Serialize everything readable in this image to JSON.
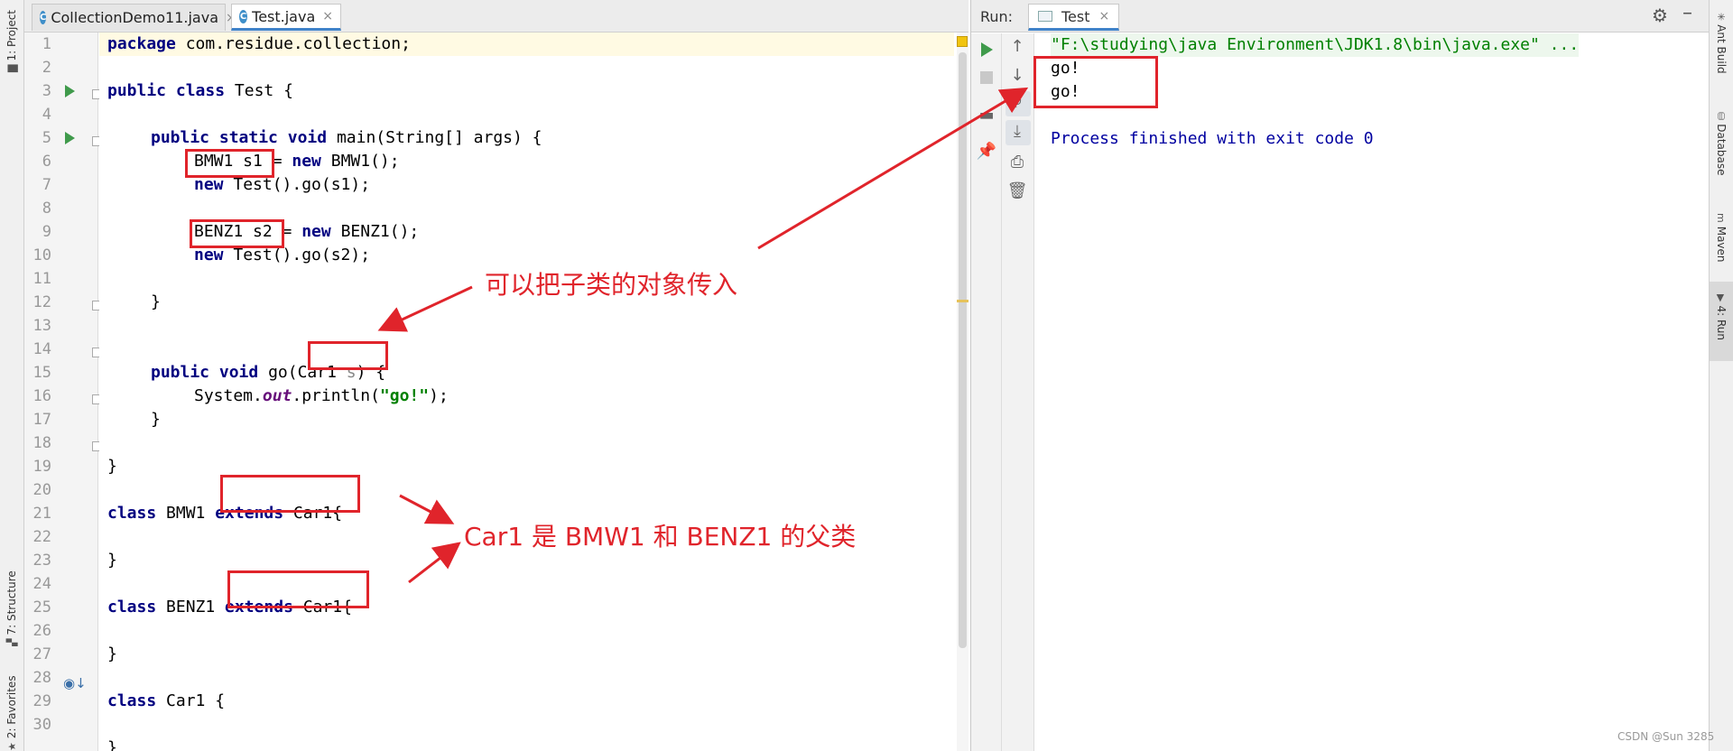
{
  "left_strip": {
    "project_label": "1: Project",
    "structure_label": "7: Structure",
    "favorites_label": "2: Favorites"
  },
  "editor": {
    "tabs": [
      {
        "label": "CollectionDemo11.java",
        "active": false
      },
      {
        "label": "Test.java",
        "active": true
      }
    ],
    "tab_close_glyph": "×",
    "line_numbers": [
      "1",
      "2",
      "3",
      "4",
      "5",
      "6",
      "7",
      "8",
      "9",
      "10",
      "11",
      "12",
      "13",
      "14",
      "15",
      "16",
      "17",
      "18",
      "19",
      "20",
      "21",
      "22",
      "23",
      "24",
      "25",
      "26",
      "27",
      "28",
      "29",
      "30"
    ],
    "code": {
      "l1_kw": "package",
      "l1_rest": " com.residue.collection;",
      "l3_kw1": "public",
      "l3_kw2": "class",
      "l3_rest": " Test {",
      "l5_kw1": "public",
      "l5_kw2": "static",
      "l5_kw3": "void",
      "l5_rest": " main(String[] args) {",
      "l6_a": "BMW1 s1",
      "l6_b": " = ",
      "l6_kw": "new",
      "l6_c": " BMW1();",
      "l7_kw": "new",
      "l7_rest": " Test().go(s1);",
      "l9_a": "BENZ1 s2",
      "l9_b": " = ",
      "l9_kw": "new",
      "l9_c": " BENZ1();",
      "l10_kw": "new",
      "l10_rest": " Test().go(s2);",
      "l12": "}",
      "l14_kw1": "public",
      "l14_kw2": "void",
      "l14_a": " go(",
      "l14_b": "Car1 ",
      "l14_param": "s",
      "l14_c": ") {",
      "l15_a": "System.",
      "l15_out": "out",
      "l15_b": ".println(",
      "l15_str": "\"go!\"",
      "l15_c": ");",
      "l16": "}",
      "l18": "}",
      "l20_kw1": "class",
      "l20_a": " BMW1 ",
      "l20_kw2": "extends",
      "l20_b": " Car1{",
      "l22": "}",
      "l24_kw1": "class",
      "l24_a": " BENZ1 ",
      "l24_kw2": "extends",
      "l24_b": " Car1{",
      "l26": "}",
      "l28_kw1": "class",
      "l28_a": " Car1 {",
      "l30": "}"
    }
  },
  "run_panel": {
    "label": "Run:",
    "tab_label": "Test",
    "tab_close_glyph": "×",
    "console": {
      "command": "\"F:\\studying\\java Environment\\JDK1.8\\bin\\java.exe\" ...",
      "output": [
        "go!",
        "go!"
      ],
      "exit_message": "Process finished with exit code 0"
    }
  },
  "right_strip": {
    "ant_label": "Ant Build",
    "database_label": "Database",
    "maven_label": "Maven",
    "run_label": "4: Run"
  },
  "annotations": {
    "subclass_note": "可以把子类的对象传入",
    "parent_note": "Car1 是 BMW1 和 BENZ1 的父类"
  },
  "colors": {
    "annotation_red": "#e0242b",
    "keyword_navy": "#000080",
    "string_green": "#008000",
    "run_green": "#3f9a4b",
    "tab_accent": "#4083c9"
  },
  "watermark": "CSDN @Sun 3285"
}
